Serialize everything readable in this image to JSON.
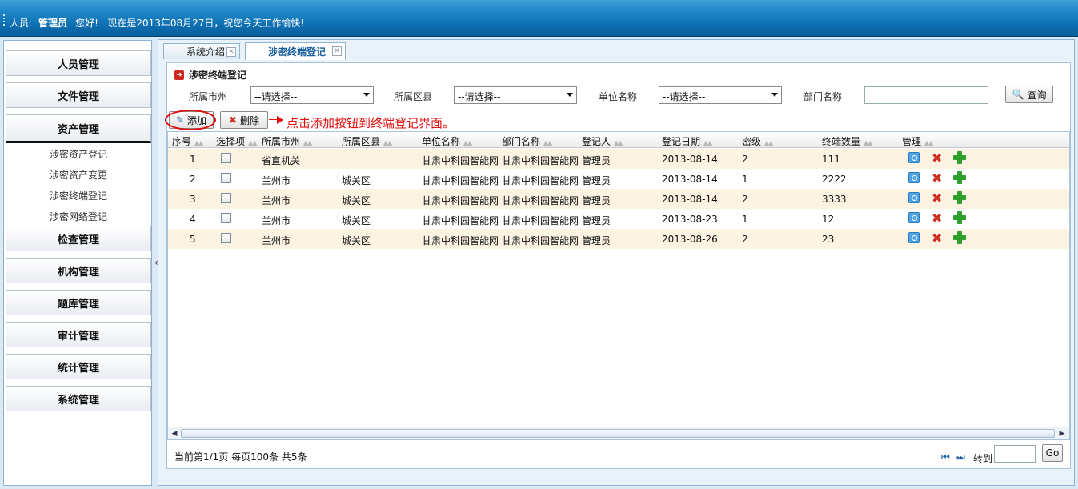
{
  "header": {
    "user_label": "人员:",
    "user_name": "管理员",
    "greeting": "您好!",
    "message": "现在是2013年08月27日，祝您今天工作愉快!"
  },
  "sidebar": {
    "menu": [
      {
        "label": "人员管理"
      },
      {
        "label": "文件管理"
      },
      {
        "label": "资产管理"
      },
      {
        "label": "检查管理"
      },
      {
        "label": "机构管理"
      },
      {
        "label": "题库管理"
      },
      {
        "label": "审计管理"
      },
      {
        "label": "统计管理"
      },
      {
        "label": "系统管理"
      }
    ],
    "sub_items": [
      {
        "label": "涉密资产登记"
      },
      {
        "label": "涉密资产变更"
      },
      {
        "label": "涉密终端登记"
      },
      {
        "label": "涉密网络登记"
      }
    ],
    "collapse_glyph": "«"
  },
  "tabs": [
    {
      "label": "系统介绍"
    },
    {
      "label": "涉密终端登记"
    }
  ],
  "panel": {
    "title": "涉密终端登记",
    "filters": {
      "city_label": "所属市州",
      "city_value": "--请选择--",
      "district_label": "所属区县",
      "district_value": "--请选择--",
      "unit_label": "单位名称",
      "unit_value": "--请选择--",
      "dept_label": "部门名称",
      "dept_value": ""
    },
    "query_button": "查询",
    "add_button": "添加",
    "delete_button": "删除",
    "annotation": "点击添加按钮到终端登记界面。"
  },
  "grid": {
    "columns": [
      "序号",
      "选择项",
      "所属市州",
      "所属区县",
      "单位名称",
      "部门名称",
      "登记人",
      "登记日期",
      "密级",
      "终端数量",
      "管理"
    ],
    "rows": [
      {
        "no": "1",
        "city": "省直机关",
        "district": "",
        "unit": "甘肃中科园智能网",
        "dept": "甘肃中科园智能网",
        "registrar": "管理员",
        "date": "2013-08-14",
        "level": "2",
        "count": "111"
      },
      {
        "no": "2",
        "city": "兰州市",
        "district": "城关区",
        "unit": "甘肃中科园智能网",
        "dept": "甘肃中科园智能网",
        "registrar": "管理员",
        "date": "2013-08-14",
        "level": "1",
        "count": "2222"
      },
      {
        "no": "3",
        "city": "兰州市",
        "district": "城关区",
        "unit": "甘肃中科园智能网",
        "dept": "甘肃中科园智能网",
        "registrar": "管理员",
        "date": "2013-08-14",
        "level": "2",
        "count": "3333"
      },
      {
        "no": "4",
        "city": "兰州市",
        "district": "城关区",
        "unit": "甘肃中科园智能网",
        "dept": "甘肃中科园智能网",
        "registrar": "管理员",
        "date": "2013-08-23",
        "level": "1",
        "count": "12"
      },
      {
        "no": "5",
        "city": "兰州市",
        "district": "城关区",
        "unit": "甘肃中科园智能网",
        "dept": "甘肃中科园智能网",
        "registrar": "管理员",
        "date": "2013-08-26",
        "level": "2",
        "count": "23"
      }
    ],
    "sort_glyph": "▲▲"
  },
  "footer": {
    "page_info": "当前第1/1页  每页100条  共5条",
    "first_glyph": "⏮",
    "last_glyph": "⏭",
    "goto_label": "转到",
    "go_button": "Go"
  },
  "colors": {
    "header_blue": "#0d6fb1",
    "odd_row": "#fcf3e3",
    "annotation_red": "#e01010"
  }
}
